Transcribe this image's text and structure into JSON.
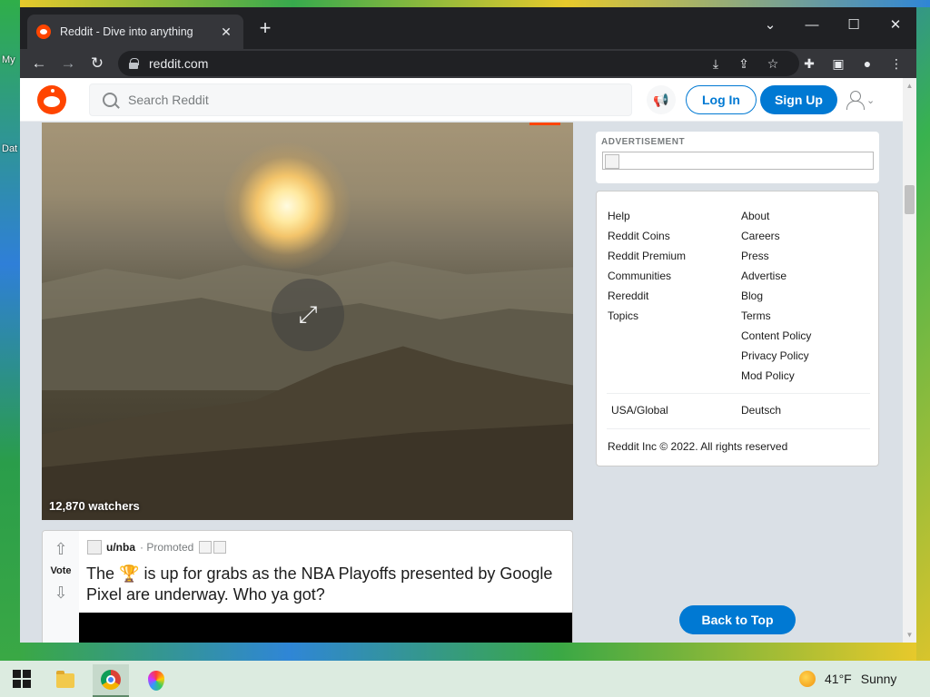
{
  "desktop": {
    "labels": [
      "My",
      "Dat"
    ]
  },
  "browser": {
    "tab_title": "Reddit - Dive into anything",
    "url": "reddit.com"
  },
  "reddit": {
    "search_placeholder": "Search Reddit",
    "login_label": "Log In",
    "signup_label": "Sign Up",
    "video": {
      "watchers": "12,870 watchers"
    },
    "post": {
      "vote_label": "Vote",
      "subreddit": "u/nba",
      "promoted": "· Promoted",
      "title_before": "The",
      "title_after": "is up for grabs as the NBA Playoffs presented by Google Pixel are underway. Who ya got?"
    },
    "ad_label": "ADVERTISEMENT",
    "footer": {
      "col1": [
        "Help",
        "Reddit Coins",
        "Reddit Premium",
        "Communities",
        "Rereddit",
        "Topics"
      ],
      "col2": [
        "About",
        "Careers",
        "Press",
        "Advertise",
        "Blog",
        "Terms",
        "Content Policy",
        "Privacy Policy",
        "Mod Policy"
      ],
      "lang1": "USA/Global",
      "lang2": "Deutsch",
      "copyright": "Reddit Inc © 2022. All rights reserved"
    },
    "back_to_top": "Back to Top"
  },
  "taskbar": {
    "temperature": "41°F",
    "condition": "Sunny"
  }
}
